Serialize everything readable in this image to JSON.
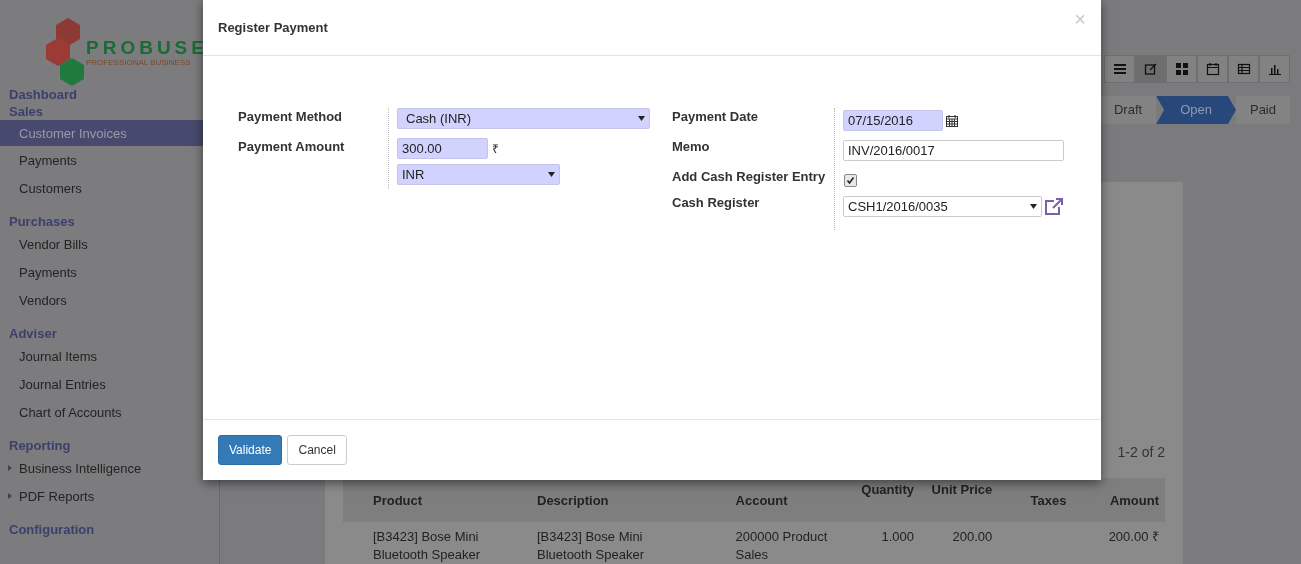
{
  "sidebar": {
    "logo": {
      "name": "PROBUSE",
      "tagline": "PROFESSIONAL BUSINESS"
    },
    "sections": [
      {
        "title": "Dashboard"
      },
      {
        "title": "Sales",
        "items": [
          {
            "label": "Customer Invoices",
            "kind": "link",
            "selected": true
          },
          {
            "label": "Payments",
            "kind": "link",
            "selected": false
          },
          {
            "label": "Customers",
            "kind": "link",
            "selected": false
          }
        ]
      },
      {
        "title": "Purchases",
        "items": [
          {
            "label": "Vendor Bills",
            "kind": "link",
            "selected": false
          },
          {
            "label": "Payments",
            "kind": "link",
            "selected": false
          },
          {
            "label": "Vendors",
            "kind": "link",
            "selected": false
          }
        ]
      },
      {
        "title": "Adviser",
        "items": [
          {
            "label": "Journal Items",
            "kind": "link",
            "selected": false
          },
          {
            "label": "Journal Entries",
            "kind": "link",
            "selected": false
          },
          {
            "label": "Chart of Accounts",
            "kind": "link",
            "selected": false
          }
        ]
      },
      {
        "title": "Reporting",
        "items": [
          {
            "label": "Business Intelligence",
            "kind": "folder",
            "selected": false
          },
          {
            "label": "PDF Reports",
            "kind": "folder",
            "selected": false
          }
        ]
      },
      {
        "title": "Configuration"
      }
    ]
  },
  "view_switcher": [
    {
      "kind": "list",
      "selected": false
    },
    {
      "kind": "form",
      "selected": true
    },
    {
      "kind": "kanban",
      "selected": false
    },
    {
      "kind": "calendar",
      "selected": false
    },
    {
      "kind": "pivot",
      "selected": false
    },
    {
      "kind": "graph",
      "selected": false
    }
  ],
  "status_bar": [
    {
      "label": "Draft",
      "selected": false
    },
    {
      "label": "Open",
      "selected": true
    },
    {
      "label": "Paid",
      "selected": false
    }
  ],
  "pager": "1-2 of 2",
  "table": {
    "columns": [
      "Product",
      "Description",
      "Account",
      "Quantity",
      "Unit Price",
      "Taxes",
      "Amount"
    ],
    "rows": [
      {
        "cells": [
          "[B3423] Bose Mini Bluetooth Speaker",
          "[B3423] Bose Mini Bluetooth Speaker",
          "200000 Product Sales",
          "1.000",
          "200.00",
          "",
          "200.00 ₹"
        ]
      }
    ]
  },
  "dialog": {
    "title": "Register Payment",
    "close": "×",
    "left_fields": [
      {
        "label": "Payment Method",
        "kind": "select",
        "value": "Cash (INR)",
        "required": true
      },
      {
        "label": "Payment Amount",
        "kind": "monetary",
        "value": "300.00",
        "symbol": "₹",
        "currency": "INR",
        "required": true
      }
    ],
    "right_fields": [
      {
        "label": "Payment Date",
        "kind": "date",
        "value": "07/15/2016",
        "required": true
      },
      {
        "label": "Memo",
        "kind": "text",
        "value": "INV/2016/0017",
        "required": false
      },
      {
        "label": "Add Cash Register Entry",
        "kind": "checkbox",
        "checked": true
      },
      {
        "label": "Cash Register",
        "kind": "many2one",
        "value": "CSH1/2016/0035",
        "required": false
      }
    ],
    "buttons": [
      {
        "label": "Validate",
        "kind": "primary"
      },
      {
        "label": "Cancel",
        "kind": "default"
      }
    ]
  }
}
